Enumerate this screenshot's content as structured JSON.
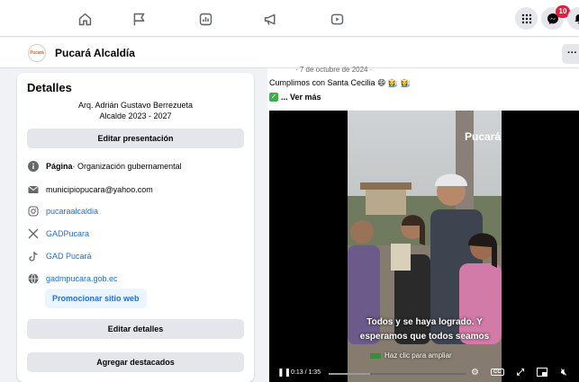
{
  "nav": {
    "icons": [
      "home-icon",
      "flag-icon",
      "insights-icon",
      "megaphone-icon",
      "video-icon"
    ],
    "right_icons": [
      "apps-grid-icon",
      "messenger-icon",
      "notifications-icon"
    ],
    "messenger_badge": "10"
  },
  "page": {
    "name": "Pucará Alcaldía",
    "logo_text": "Pucará",
    "more": "···"
  },
  "details": {
    "title": "Detalles",
    "bio_line1": "Arq. Adrián Gustavo Berrezueta",
    "bio_line2": "Alcalde 2023 - 2027",
    "edit_presentation": "Editar presentación",
    "category_label": "Página",
    "category_value": " · Organización gubernamental",
    "email": "municipiopucara@yahoo.com",
    "instagram": "pucaraalcaldia",
    "x_account": "GADPucara",
    "tiktok": "GAD Pucará",
    "website": "gadmpucara.gob.ec",
    "promote_website": "Promocionar sitio web",
    "edit_details": "Editar detalles",
    "add_featured": "Agregar destacados"
  },
  "post": {
    "date": "· 7 de octubre de 2024 ·",
    "caption": "Cumplimos con Santa Cecilia 😄 👩‍🌾 👩‍🌾",
    "see_more": "... Ver más",
    "video": {
      "watermark": "Pucará",
      "subtitle_line1": "Todos y se haya logrado. Y",
      "subtitle_line2": "esperamos que todos seamos",
      "enlarge_hint": "Haz clic para ampliar",
      "timecode": "0:13 / 1:35",
      "progress": 0.137,
      "cc_label": "CC"
    }
  },
  "colors": {
    "link": "#216fdb",
    "badge": "#e41e3f",
    "button_bg": "#e4e6eb"
  }
}
